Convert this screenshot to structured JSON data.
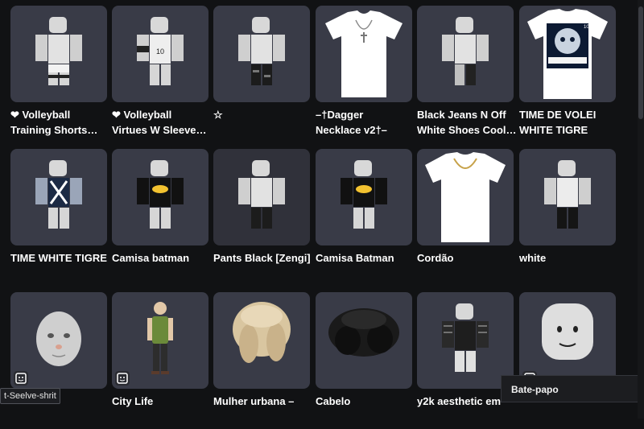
{
  "items": [
    {
      "name_line1": "❤ Volleyball",
      "name_line2": "Training Shorts…",
      "thumb": "avatar-white-shorts"
    },
    {
      "name_line1": "❤ Volleyball",
      "name_line2": "Virtues W Sleeve…",
      "thumb": "avatar-jersey-10"
    },
    {
      "name_line1": "☆",
      "name_line2": "",
      "thumb": "avatar-black-pants"
    },
    {
      "name_line1": "–†Dagger",
      "name_line2": "Necklace v2†–",
      "thumb": "tshirt-necklace"
    },
    {
      "name_line1": "Black Jeans N Off",
      "name_line2": "White Shoes Cool…",
      "thumb": "avatar-black-jeans"
    },
    {
      "name_line1": "TIME DE VOLEI",
      "name_line2": "WHITE TIGRE",
      "thumb": "tshirt-white-tiger"
    },
    {
      "name_line1": "TIME WHITE TIGRE",
      "name_line2": "",
      "thumb": "avatar-tiger-shirt"
    },
    {
      "name_line1": "Camisa batman",
      "name_line2": "",
      "thumb": "avatar-batman"
    },
    {
      "name_line1": "Pants Black [Zengi]",
      "name_line2": "",
      "thumb": "avatar-zengi-pants"
    },
    {
      "name_line1": "Camisa Batman",
      "name_line2": "",
      "thumb": "avatar-batman-2"
    },
    {
      "name_line1": "Cordão",
      "name_line2": "",
      "thumb": "tshirt-gold-chain"
    },
    {
      "name_line1": "white",
      "name_line2": "",
      "thumb": "avatar-white-black-pants"
    },
    {
      "name_line1": "",
      "name_line2": "",
      "thumb": "head-face",
      "has_badge": true
    },
    {
      "name_line1": "City Life",
      "name_line2": "",
      "thumb": "avatar-city-life",
      "has_badge": true
    },
    {
      "name_line1": "Mulher urbana –",
      "name_line2": "",
      "thumb": "blonde-hair"
    },
    {
      "name_line1": "Cabelo",
      "name_line2": "",
      "thumb": "black-hair"
    },
    {
      "name_line1": "y2k aesthetic em",
      "name_line2": "",
      "thumb": "avatar-plaid"
    },
    {
      "name_line1": "",
      "name_line2": "",
      "thumb": "classic-head",
      "has_badge": true
    }
  ],
  "tooltip_text": "t-Seelve-shrit",
  "chat_label": "Bate-papo",
  "colors": {
    "tile": "#393b47",
    "background": "#111214",
    "text": "#ffffff"
  }
}
